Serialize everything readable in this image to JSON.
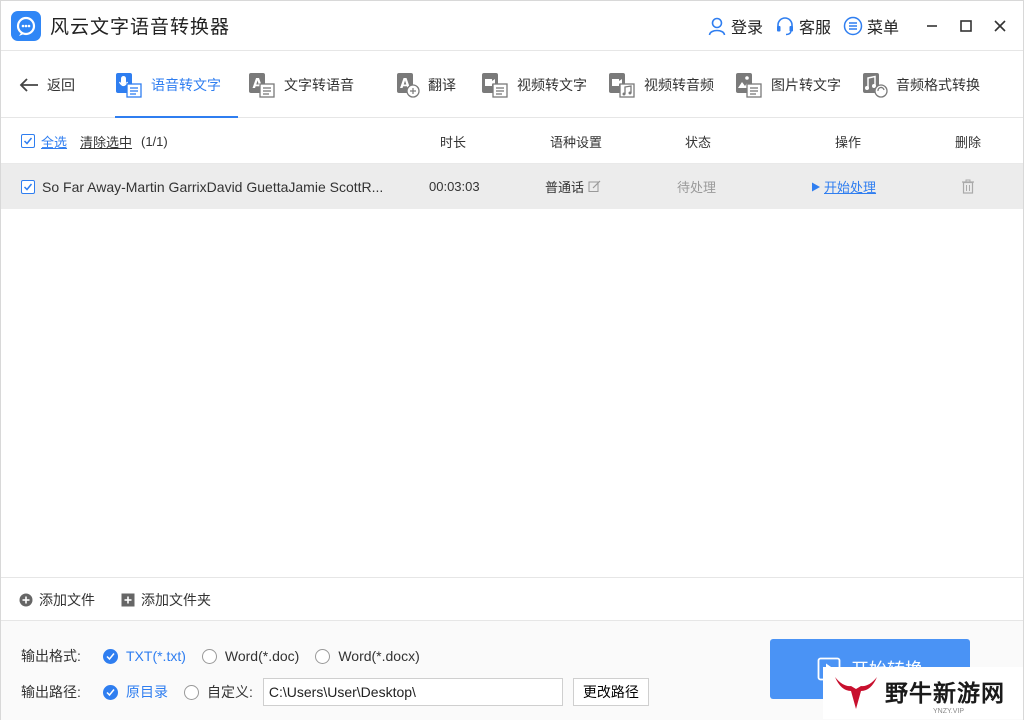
{
  "app": {
    "title": "风云文字语音转换器",
    "brand_color": "#2f86f6",
    "accent_color": "#2f7ef0"
  },
  "titlebar": {
    "login": "登录",
    "service": "客服",
    "menu": "菜单",
    "icons": [
      "user-icon",
      "headset-icon",
      "menu-icon",
      "minimize-icon",
      "maximize-icon",
      "close-icon"
    ]
  },
  "nav": {
    "back": "返回",
    "tabs": [
      {
        "label": "语音转文字",
        "icon": "microphone-doc-icon",
        "active": true
      },
      {
        "label": "文字转语音",
        "icon": "text-to-speech-icon",
        "active": false
      },
      {
        "label": "翻译",
        "icon": "translate-icon",
        "active": false
      },
      {
        "label": "视频转文字",
        "icon": "video-to-text-icon",
        "active": false
      },
      {
        "label": "视频转音频",
        "icon": "video-to-audio-icon",
        "active": false
      },
      {
        "label": "图片转文字",
        "icon": "image-to-text-icon",
        "active": false
      },
      {
        "label": "音频格式转换",
        "icon": "audio-format-icon",
        "active": false
      }
    ]
  },
  "table": {
    "select_all": "全选",
    "clear_selection": "清除选中",
    "count": "(1/1)",
    "headers": {
      "duration": "时长",
      "language": "语种设置",
      "status": "状态",
      "action": "操作",
      "delete": "删除"
    },
    "rows": [
      {
        "checked": true,
        "name": "So Far Away-Martin GarrixDavid GuettaJamie ScottR...",
        "duration": "00:03:03",
        "language": "普通话",
        "status": "待处理",
        "action": "开始处理"
      }
    ]
  },
  "addbar": {
    "add_file": "添加文件",
    "add_folder": "添加文件夹"
  },
  "output": {
    "format_label": "输出格式:",
    "formats": [
      {
        "label": "TXT(*.txt)",
        "selected": true
      },
      {
        "label": "Word(*.doc)",
        "selected": false
      },
      {
        "label": "Word(*.docx)",
        "selected": false
      }
    ],
    "path_label": "输出路径:",
    "path_options": [
      {
        "label": "原目录",
        "selected": true
      },
      {
        "label": "自定义:",
        "selected": false
      }
    ],
    "path_value": "C:\\Users\\User\\Desktop\\",
    "change_path": "更改路径",
    "start_button": "开始转换"
  },
  "watermark": {
    "text": "野牛新游网",
    "sub": "YNZY.VIP"
  }
}
